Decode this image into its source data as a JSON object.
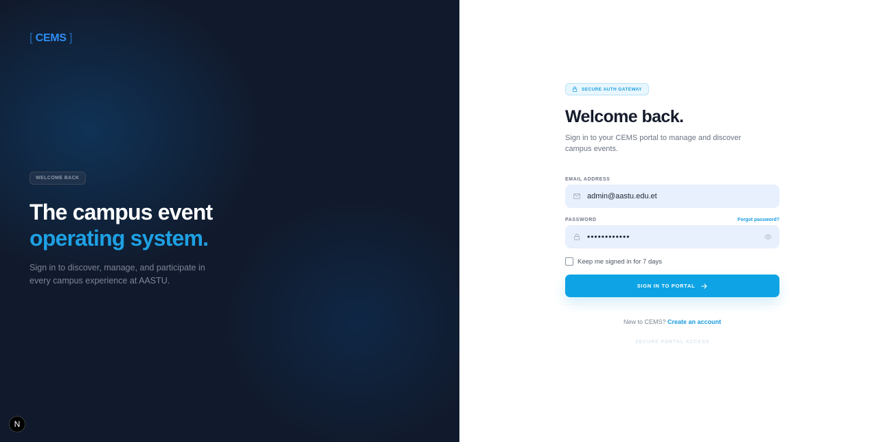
{
  "left": {
    "logo": "CEMS",
    "welcome_badge": "WELCOME BACK",
    "hero_line1": "The campus event",
    "hero_line2": "operating system.",
    "subtitle": "Sign in to discover, manage, and participate in every campus experience at AASTU.",
    "next_badge": "N"
  },
  "form": {
    "badge": "SECURE AUTH GATEWAY",
    "title": "Welcome back.",
    "description": "Sign in to your CEMS portal to manage and discover campus events.",
    "email_label": "EMAIL ADDRESS",
    "email_value": "admin@aastu.edu.et",
    "password_label": "PASSWORD",
    "forgot_link": "Forgot password?",
    "password_value": "••••••••••••",
    "remember_label": "Keep me signed in for 7 days",
    "submit_label": "SIGN IN TO PORTAL",
    "new_prompt": "New to CEMS?",
    "create_link": "Create an account",
    "footer_note": "SECURE PORTAL ACCESS"
  },
  "colors": {
    "accent": "#0ea3e4",
    "left_background": "#111a2c",
    "hero_highlight": "#1ea0e3"
  },
  "icons": {
    "badge": "lock-icon",
    "email": "mail-icon",
    "password": "lock-icon",
    "visibility": "eye-icon",
    "submit": "arrow-right-icon"
  }
}
